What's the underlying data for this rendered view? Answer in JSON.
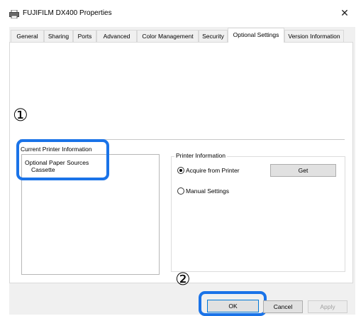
{
  "window": {
    "title": "FUJIFILM DX400 Properties",
    "close_glyph": "✕"
  },
  "tabs": [
    {
      "label": "General"
    },
    {
      "label": "Sharing"
    },
    {
      "label": "Ports"
    },
    {
      "label": "Advanced"
    },
    {
      "label": "Color Management"
    },
    {
      "label": "Security"
    },
    {
      "label": "Optional Settings",
      "active": true
    },
    {
      "label": "Version Information"
    }
  ],
  "callouts": {
    "one": "①",
    "two": "②"
  },
  "current_info": {
    "label": "Current Printer Information",
    "items": [
      "Optional Paper Sources",
      "Cassette"
    ]
  },
  "printer_info": {
    "label": "Printer Information",
    "acquire_label": "Acquire from Printer",
    "acquire_checked": true,
    "get_label": "Get",
    "manual_label": "Manual Settings",
    "manual_checked": false
  },
  "buttons": {
    "ok": "OK",
    "cancel": "Cancel",
    "apply": "Apply"
  },
  "colors": {
    "highlight": "#1a73e8",
    "window_bg": "#f0f0f0"
  },
  "icons": {
    "title": "printer-icon",
    "close": "close-icon"
  }
}
